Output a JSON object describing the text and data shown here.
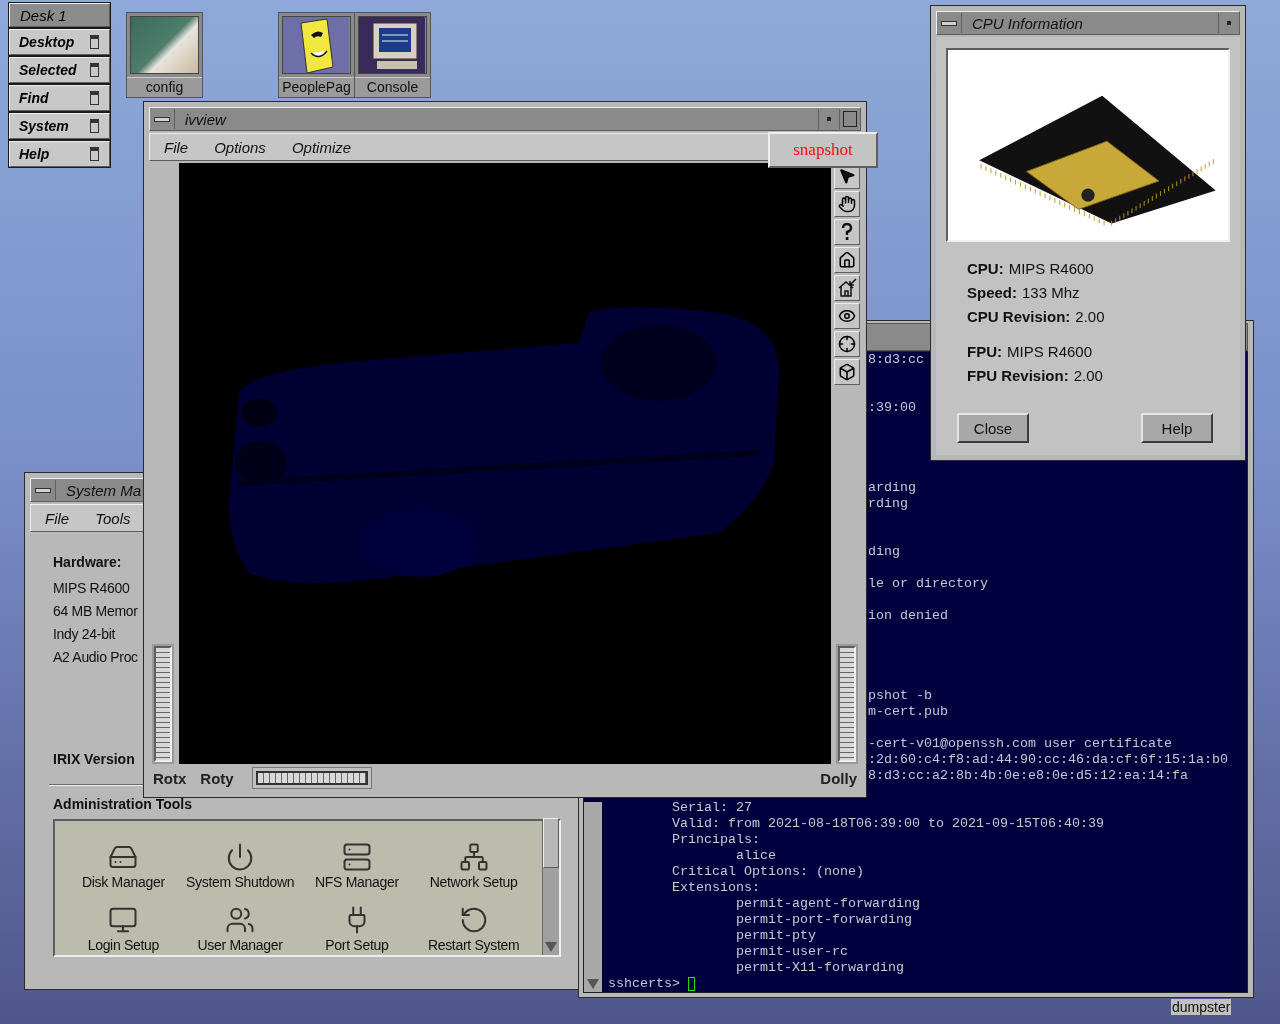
{
  "desk_panel": {
    "title": "Desk 1",
    "items": [
      "Desktop",
      "Selected",
      "Find",
      "System",
      "Help"
    ]
  },
  "desktop_icons": [
    {
      "label": "config",
      "kind": "photo"
    },
    {
      "label": "PeoplePag",
      "kind": "book"
    },
    {
      "label": "Console",
      "kind": "monitor"
    }
  ],
  "terminal": {
    "lines": [
      {
        "kind": "fragment",
        "text": "8:d3:cc"
      },
      {
        "kind": "fragment",
        "text": ":39:00"
      },
      {
        "kind": "fragment",
        "text": "arding"
      },
      {
        "kind": "fragment",
        "text": "rding"
      },
      {
        "kind": "fragment",
        "text": "ding"
      },
      {
        "kind": "fragment",
        "text": "le or directory"
      },
      {
        "kind": "fragment",
        "text": "ion denied"
      },
      {
        "kind": "fragment",
        "text": "pshot -b"
      },
      {
        "kind": "fragment",
        "text": "m-cert.pub"
      },
      {
        "kind": "fragment",
        "text": "-cert-v01@openssh.com user certificate"
      },
      {
        "kind": "fragment",
        "text": ":2d:60:c4:f8:ad:44:90:cc:46:da:cf:6f:15:1a:b0"
      },
      {
        "kind": "fragment",
        "text": "8:d3:cc:a2:8b:4b:0e:e8:0e:d5:12:ea:14:fa"
      },
      {
        "kind": "field",
        "text": "Serial: 27"
      },
      {
        "kind": "field",
        "text": "Valid: from 2021-08-18T06:39:00 to 2021-09-15T06:40:39"
      },
      {
        "kind": "field",
        "text": "Principals:"
      },
      {
        "kind": "value",
        "text": "alice"
      },
      {
        "kind": "field",
        "text": "Critical Options: (none)"
      },
      {
        "kind": "field",
        "text": "Extensions:"
      },
      {
        "kind": "value",
        "text": "permit-agent-forwarding"
      },
      {
        "kind": "value",
        "text": "permit-port-forwarding"
      },
      {
        "kind": "value",
        "text": "permit-pty"
      },
      {
        "kind": "value",
        "text": "permit-user-rc"
      },
      {
        "kind": "value",
        "text": "permit-X11-forwarding"
      }
    ],
    "prompt": "sshcerts>"
  },
  "system_manager": {
    "title": "System Ma",
    "menu": [
      "File",
      "Tools"
    ],
    "hardware_heading": "Hardware:",
    "hardware": [
      "MIPS R4600",
      "64 MB Memor",
      "Indy 24-bit",
      "A2 Audio Proc"
    ],
    "irix_heading": "IRIX Version",
    "admin_heading": "Administration Tools",
    "tools": [
      {
        "label": "Disk Manager",
        "kind": "disk"
      },
      {
        "label": "System Shutdown",
        "kind": "shutdown"
      },
      {
        "label": "NFS Manager",
        "kind": "nfs"
      },
      {
        "label": "Network Setup",
        "kind": "network"
      },
      {
        "label": "Login Setup",
        "kind": "login"
      },
      {
        "label": "User Manager",
        "kind": "users"
      },
      {
        "label": "Port Setup",
        "kind": "port"
      },
      {
        "label": "Restart System",
        "kind": "restart"
      }
    ]
  },
  "cpu_window": {
    "title": "CPU Information",
    "groups": [
      [
        {
          "label": "CPU:",
          "value": "MIPS R4600"
        },
        {
          "label": "Speed:",
          "value": "133 Mhz"
        },
        {
          "label": "CPU Revision:",
          "value": "2.00"
        }
      ],
      [
        {
          "label": "FPU:",
          "value": "MIPS R4600"
        },
        {
          "label": "FPU Revision:",
          "value": "2.00"
        }
      ]
    ],
    "buttons": [
      "Close",
      "Help"
    ]
  },
  "ivview": {
    "title": "ivview",
    "menu": [
      "File",
      "Options",
      "Optimize"
    ],
    "snapshot": "snapshot",
    "wheel_labels": [
      "Rotx",
      "Roty"
    ],
    "dolly": "Dolly"
  },
  "dumpster": "dumpster"
}
